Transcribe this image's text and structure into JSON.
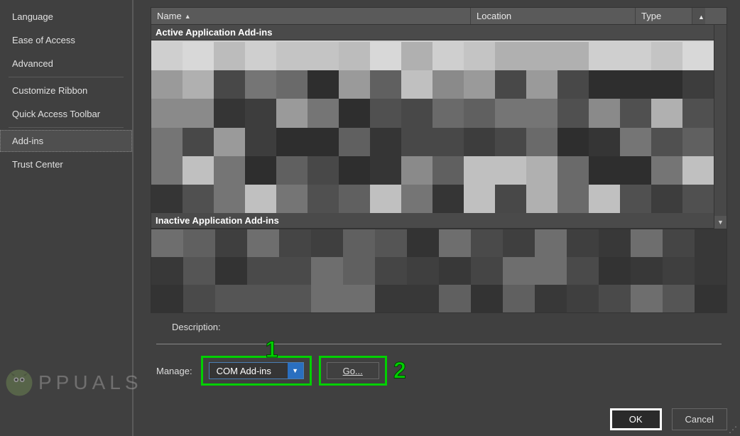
{
  "sidebar": {
    "items": [
      {
        "label": "Language"
      },
      {
        "label": "Ease of Access"
      },
      {
        "label": "Advanced"
      },
      {
        "label": "Customize Ribbon"
      },
      {
        "label": "Quick Access Toolbar"
      },
      {
        "label": "Add-ins"
      },
      {
        "label": "Trust Center"
      }
    ],
    "selected_index": 5
  },
  "table": {
    "columns": {
      "name": "Name",
      "location": "Location",
      "type": "Type"
    },
    "groups": {
      "active": "Active Application Add-ins",
      "inactive": "Inactive Application Add-ins"
    }
  },
  "description": {
    "label": "Description:"
  },
  "manage": {
    "label": "Manage:",
    "selected": "COM Add-ins",
    "go_label": "Go..."
  },
  "annotations": {
    "one": "1",
    "two": "2"
  },
  "footer": {
    "ok": "OK",
    "cancel": "Cancel"
  },
  "watermark": {
    "text": "PPUALS"
  }
}
